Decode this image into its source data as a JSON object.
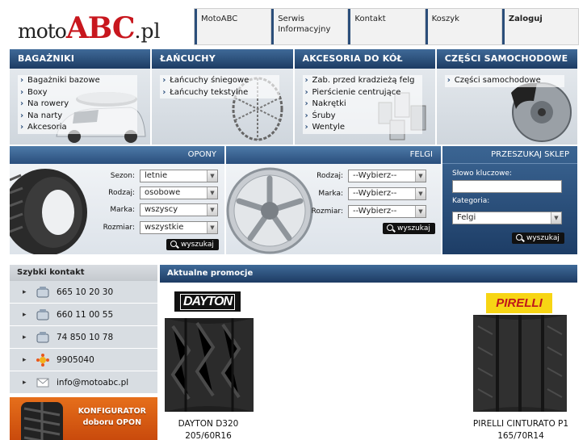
{
  "logo": {
    "a": "moto",
    "b": "ABC",
    "c": ".pl"
  },
  "topnav": [
    {
      "label": "MotoABC"
    },
    {
      "label": "Serwis Informacyjny"
    },
    {
      "label": "Kontakt"
    },
    {
      "label": "Koszyk"
    },
    {
      "label": "Zaloguj"
    }
  ],
  "categories": [
    {
      "title": "BAGAŻNIKI",
      "items": [
        "Bagażniki bazowe",
        "Boxy",
        "Na rowery",
        "Na narty",
        "Akcesoria"
      ]
    },
    {
      "title": "ŁAŃCUCHY",
      "items": [
        "Łańcuchy śniegowe",
        "Łańcuchy tekstylne"
      ]
    },
    {
      "title": "AKCESORIA DO KÓŁ",
      "items": [
        "Zab. przed kradzieżą felg",
        "Pierścienie centrujące",
        "Nakrętki",
        "Śruby",
        "Wentyle"
      ]
    },
    {
      "title": "CZĘŚCI SAMOCHODOWE",
      "items": [
        "Części samochodowe"
      ]
    }
  ],
  "opony": {
    "title": "OPONY",
    "fields": [
      {
        "label": "Sezon:",
        "value": "letnie"
      },
      {
        "label": "Rodzaj:",
        "value": "osobowe"
      },
      {
        "label": "Marka:",
        "value": "wszyscy"
      },
      {
        "label": "Rozmiar:",
        "value": "wszystkie"
      }
    ],
    "button": "wyszukaj"
  },
  "felgi": {
    "title": "FELGI",
    "fields": [
      {
        "label": "Rodzaj:",
        "value": "--Wybierz--"
      },
      {
        "label": "Marka:",
        "value": "--Wybierz--"
      },
      {
        "label": "Rozmiar:",
        "value": "--Wybierz--"
      }
    ],
    "button": "wyszukaj"
  },
  "sklep": {
    "title": "PRZESZUKAJ SKLEP",
    "keyword_label": "Słowo kluczowe:",
    "keyword_value": "",
    "category_label": "Kategoria:",
    "category_value": "Felgi",
    "button": "wyszukaj"
  },
  "kontakt": {
    "title": "Szybki kontakt",
    "rows": [
      {
        "icon": "phone-icon",
        "text": "665 10 20 30"
      },
      {
        "icon": "phone-icon",
        "text": "660 11 00 55"
      },
      {
        "icon": "phone-icon",
        "text": "74 850 10 78"
      },
      {
        "icon": "gadu-gadu-icon",
        "text": "9905040"
      },
      {
        "icon": "email-icon",
        "text": "info@motoabc.pl"
      }
    ]
  },
  "konfigurator": {
    "line1": "KONFIGURATOR",
    "line2": "doboru OPON"
  },
  "promo": {
    "title": "Aktualne promocje",
    "products": [
      {
        "brand": "DAYTON",
        "name": "DAYTON D320",
        "size": "205/60R16"
      },
      {
        "brand": "PIRELLI",
        "name": "PIRELLI CINTURATO P1",
        "size": "165/70R14"
      }
    ]
  },
  "colors": {
    "brand_red": "#c8171e",
    "header_blue": "#1d3b63",
    "accent_orange": "#e66f1b"
  }
}
